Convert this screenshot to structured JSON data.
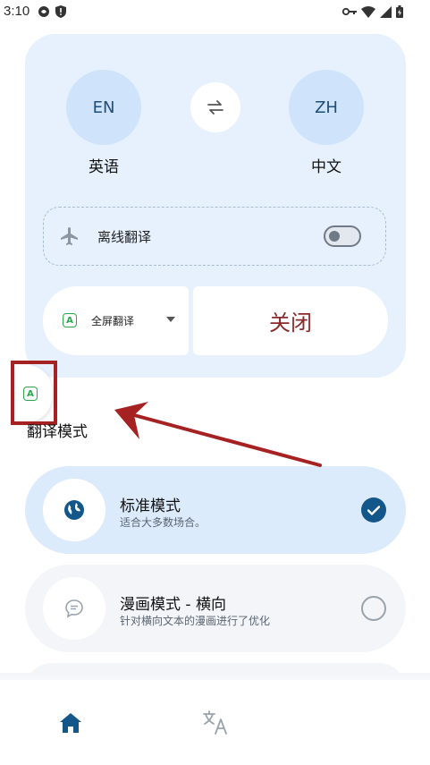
{
  "status_bar": {
    "time": "3:10"
  },
  "languages": {
    "source_code": "EN",
    "source_name": "英语",
    "target_code": "ZH",
    "target_name": "中文"
  },
  "offline": {
    "label": "离线翻译",
    "enabled": false
  },
  "controls": {
    "mode_select_label": "全屏翻译",
    "app_badge": "A",
    "close_label": "关闭"
  },
  "section": {
    "title": "翻译模式"
  },
  "modes": [
    {
      "title": "标准模式",
      "subtitle": "适合大多数场合。",
      "selected": true
    },
    {
      "title": "漫画模式 - 横向",
      "subtitle": "针对横向文本的漫画进行了优化",
      "selected": false
    }
  ],
  "colors": {
    "panel_bg": "#e6f1fd",
    "accent": "#13568a",
    "close_text": "#8b2a2a",
    "badge_green": "#2aa84a",
    "annotation_red": "#a62222"
  }
}
